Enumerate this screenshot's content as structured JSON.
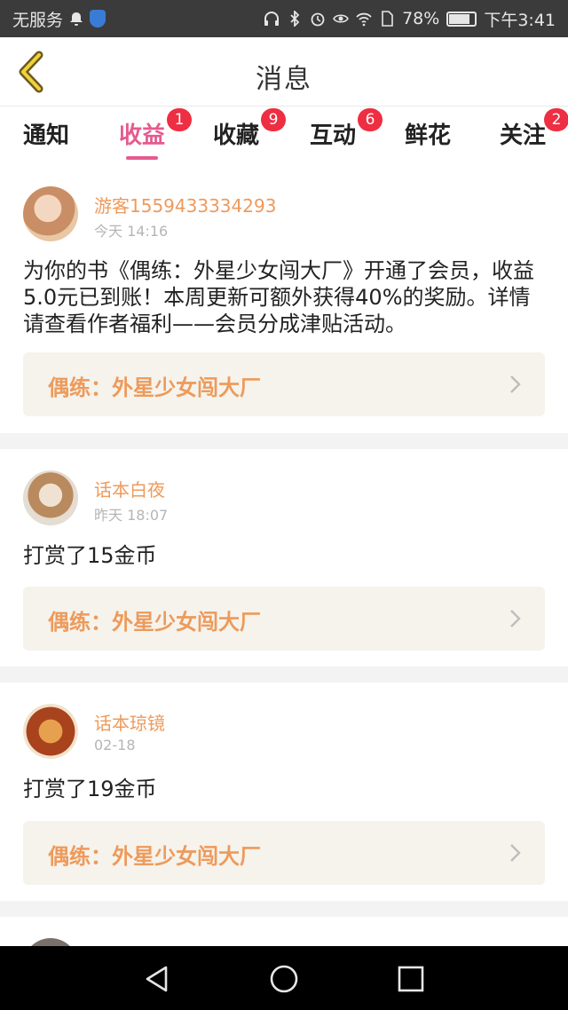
{
  "status_bar": {
    "carrier": "无服务",
    "battery": "78%",
    "time": "下午3:41"
  },
  "header": {
    "title": "消息"
  },
  "tabs": [
    {
      "label": "通知",
      "badge": ""
    },
    {
      "label": "收益",
      "badge": "1"
    },
    {
      "label": "收藏",
      "badge": "9"
    },
    {
      "label": "互动",
      "badge": "6"
    },
    {
      "label": "鲜花",
      "badge": ""
    },
    {
      "label": "关注",
      "badge": "2"
    }
  ],
  "messages": [
    {
      "user": "游客1559433334293",
      "time": "今天  14:16",
      "content": "为你的书《偶练：外星少女闯大厂》开通了会员，收益5.0元已到账！本周更新可额外获得40%的奖励。详情请查看作者福利——会员分成津贴活动。",
      "book": "偶练：外星少女闯大厂"
    },
    {
      "user": "话本白夜",
      "time": "昨天  18:07",
      "content": "打赏了15金币",
      "book": "偶练：外星少女闯大厂"
    },
    {
      "user": "话本琼镜",
      "time": "02-18",
      "content": "打赏了19金币",
      "book": "偶练：外星少女闯大厂"
    }
  ],
  "colors": {
    "accent": "#e45b8d",
    "badge": "#ee2e42",
    "username": "#ee9a5b",
    "book_bg": "#f5f3ec"
  }
}
